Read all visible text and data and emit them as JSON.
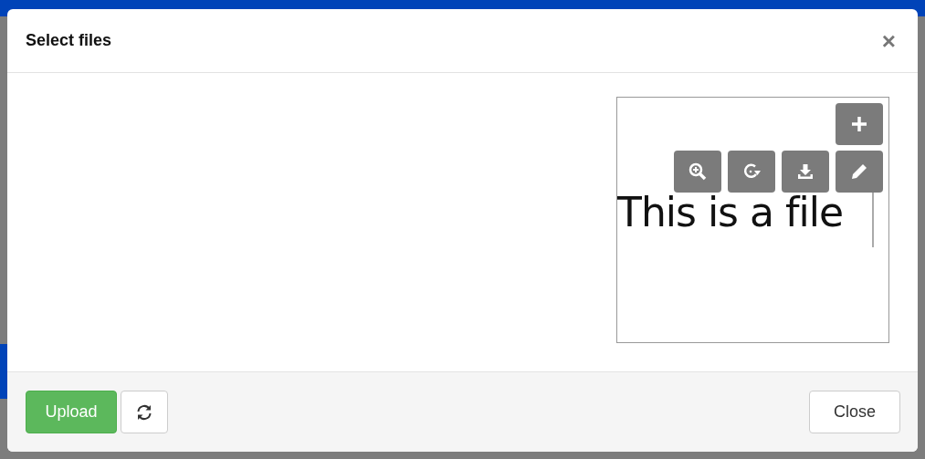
{
  "dialog": {
    "title": "Select files",
    "close_glyph": "×"
  },
  "preview": {
    "document_text": "This is a file",
    "tools": [
      {
        "kind": "add"
      },
      {
        "kind": "zoom"
      },
      {
        "kind": "rotate"
      },
      {
        "kind": "download"
      },
      {
        "kind": "edit"
      }
    ]
  },
  "footer": {
    "upload_button": "Upload",
    "close_button": "Close"
  }
}
